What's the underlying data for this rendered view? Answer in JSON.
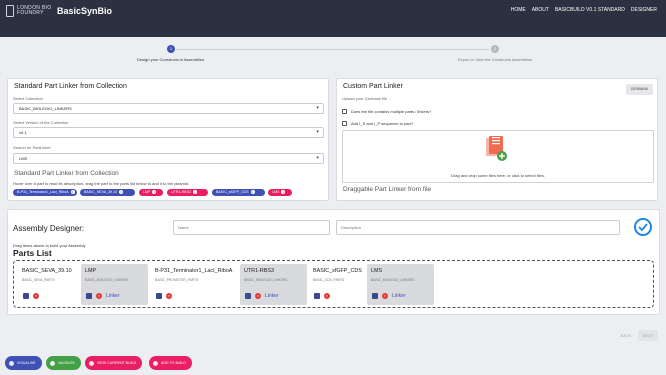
{
  "header": {
    "logo_line1": "LONDON BIO",
    "logo_line2": "FOUNDRY",
    "brand": "BasicSynBio",
    "nav": [
      "HOME",
      "ABOUT",
      "BASICBUILD V0.1 STANDARD",
      "DESIGNER"
    ]
  },
  "stepper": {
    "steps": [
      {
        "number": "1",
        "label": "Design your Constructs in Assemblies"
      },
      {
        "number": "2",
        "label": "Export or View the Constructs Assemblies"
      }
    ]
  },
  "standard": {
    "title": "Standard Part Linker from Collection",
    "collection_label": "Select Collection",
    "collection_value": "BASIC_BIOLEGIO_LINKERS",
    "version_label": "Select Version of the Collection",
    "version_value": "v0.1",
    "search_label": "Search for PartLinker",
    "search_value": "LMS",
    "draggable_title": "Standard Part Linker from Collection",
    "hint": "Hover over a part to read its description, drag the part to the parts list below to add it to the plasmid.",
    "chips": [
      {
        "label": "B-P31_Terminator1_LacI_RiboA",
        "color": "#3f51b5"
      },
      {
        "label": "BASIC_SEVA_39.10",
        "color": "#3f51b5"
      },
      {
        "label": "LMP",
        "color": "#e91e63"
      },
      {
        "label": "UTR1-RBS3",
        "color": "#e91e63"
      },
      {
        "label": "BASIC_sfGFP_CDS",
        "color": "#3f51b5"
      },
      {
        "label": "LMS",
        "color": "#e91e63"
      }
    ]
  },
  "custom": {
    "title": "Custom Part Linker",
    "upload_label": "Upload your Genbank file",
    "genbank_button": "GENBANK",
    "checkbox1": "Does the file contains multiple parts / linkers?",
    "checkbox2": "Add I_S and I_P sequence to part?",
    "drop_text": "Drag and drop some files here, or click to select files.",
    "draggable_title": "Draggable Part Linker from file"
  },
  "assembly": {
    "title": "Assembly Designer:",
    "name_placeholder": "Name",
    "description_placeholder": "Description",
    "drag_hint": "Drag items above to build your Assembly",
    "parts_title": "Parts List",
    "parts": [
      {
        "name": "BASIC_SEVA_39.10",
        "sub": "BASIC_SEVA_PARTS",
        "linker": "",
        "grey": false
      },
      {
        "name": "LMP",
        "sub": "BASIC_BIOLEGIO_LINKERS",
        "linker": "Linker",
        "grey": true
      },
      {
        "name": "B-P31_Terminator1_LacI_RiboA",
        "sub": "BASIC_PROMOTER_PARTS",
        "linker": "",
        "grey": false
      },
      {
        "name": "UTR1-RBS3",
        "sub": "BASIC_BIOLEGIO_LINKERS",
        "linker": "Linker",
        "grey": true
      },
      {
        "name": "BASIC_sfGFP_CDS",
        "sub": "BASIC_CDS_PARTS",
        "linker": "",
        "grey": false
      },
      {
        "name": "LMS",
        "sub": "BASIC_BIOLEGIO_LINKERS",
        "linker": "Linker",
        "grey": true
      }
    ]
  },
  "footer_nav": {
    "back": "BACK",
    "next": "NEXT"
  },
  "fabs": [
    {
      "label": "VISUALISE",
      "color": "#3f51b5"
    },
    {
      "label": "VALIDATE",
      "color": "#43a047"
    },
    {
      "label": "VIEW CURRENT BUILD",
      "color": "#e91e63"
    },
    {
      "label": "ADD TO BUILD",
      "color": "#e91e63"
    }
  ],
  "colors": {
    "header_bg": "#2b3140",
    "primary": "#3f51b5",
    "secondary": "#e91e63",
    "success": "#43a047",
    "check": "#1e88e5"
  }
}
